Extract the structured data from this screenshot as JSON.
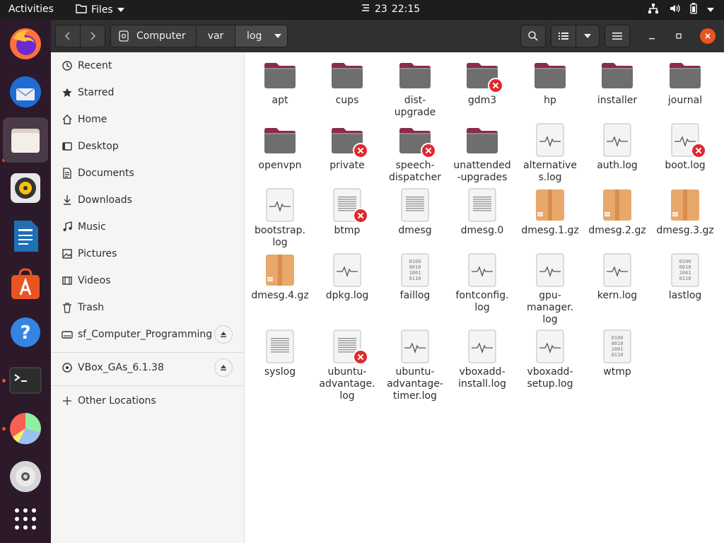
{
  "topbar": {
    "activities": "Activities",
    "app_name": "Files",
    "clock_date": "23",
    "clock_time": "22:15"
  },
  "dock": {
    "items": [
      "firefox",
      "thunderbird",
      "files",
      "rhythmbox",
      "libreoffice-writer",
      "ubuntu-software",
      "help",
      "terminal",
      "disk-usage",
      "dvd",
      "show-applications"
    ]
  },
  "breadcrumb": {
    "items": [
      "Computer",
      "var",
      "log"
    ]
  },
  "sidebar": {
    "items": [
      {
        "label": "Recent",
        "icon": "clock-icon"
      },
      {
        "label": "Starred",
        "icon": "star-icon"
      },
      {
        "label": "Home",
        "icon": "home-icon"
      },
      {
        "label": "Desktop",
        "icon": "desktop-icon"
      },
      {
        "label": "Documents",
        "icon": "document-icon"
      },
      {
        "label": "Downloads",
        "icon": "download-icon"
      },
      {
        "label": "Music",
        "icon": "music-icon"
      },
      {
        "label": "Pictures",
        "icon": "picture-icon"
      },
      {
        "label": "Videos",
        "icon": "video-icon"
      },
      {
        "label": "Trash",
        "icon": "trash-icon"
      },
      {
        "label": "sf_Computer_Programming",
        "icon": "drive-icon"
      },
      {
        "label": "VBox_GAs_6.1.38",
        "icon": "disc-icon"
      },
      {
        "label": "Other Locations",
        "icon": "plus-icon"
      }
    ]
  },
  "files": [
    {
      "name": "apt",
      "type": "folder",
      "locked": false
    },
    {
      "name": "cups",
      "type": "folder",
      "locked": false
    },
    {
      "name": "dist-\nupgrade",
      "type": "folder",
      "locked": false
    },
    {
      "name": "gdm3",
      "type": "folder",
      "locked": true
    },
    {
      "name": "hp",
      "type": "folder",
      "locked": false
    },
    {
      "name": "installer",
      "type": "folder",
      "locked": false
    },
    {
      "name": "journal",
      "type": "folder",
      "locked": false
    },
    {
      "name": "openvpn",
      "type": "folder",
      "locked": false
    },
    {
      "name": "private",
      "type": "folder",
      "locked": true
    },
    {
      "name": "speech-\ndispatcher",
      "type": "folder",
      "locked": true
    },
    {
      "name": "unattended\n-upgrades",
      "type": "folder",
      "locked": false
    },
    {
      "name": "alternative\ns.log",
      "type": "log",
      "locked": false
    },
    {
      "name": "auth.log",
      "type": "log",
      "locked": false
    },
    {
      "name": "boot.log",
      "type": "log",
      "locked": true
    },
    {
      "name": "bootstrap.\nlog",
      "type": "log",
      "locked": false
    },
    {
      "name": "btmp",
      "type": "text",
      "locked": true
    },
    {
      "name": "dmesg",
      "type": "text",
      "locked": false
    },
    {
      "name": "dmesg.0",
      "type": "text",
      "locked": false
    },
    {
      "name": "dmesg.1.gz",
      "type": "archive",
      "locked": false
    },
    {
      "name": "dmesg.2.gz",
      "type": "archive",
      "locked": false
    },
    {
      "name": "dmesg.3.gz",
      "type": "archive",
      "locked": false
    },
    {
      "name": "dmesg.4.gz",
      "type": "archive",
      "locked": false
    },
    {
      "name": "dpkg.log",
      "type": "log",
      "locked": false
    },
    {
      "name": "faillog",
      "type": "binary",
      "locked": false
    },
    {
      "name": "fontconfig.\nlog",
      "type": "log",
      "locked": false
    },
    {
      "name": "gpu-\nmanager.\nlog",
      "type": "log",
      "locked": false
    },
    {
      "name": "kern.log",
      "type": "log",
      "locked": false
    },
    {
      "name": "lastlog",
      "type": "binary",
      "locked": false
    },
    {
      "name": "syslog",
      "type": "text",
      "locked": false
    },
    {
      "name": "ubuntu-\nadvantage.\nlog",
      "type": "text",
      "locked": true
    },
    {
      "name": "ubuntu-\nadvantage-\ntimer.log",
      "type": "log",
      "locked": false
    },
    {
      "name": "vboxadd-\ninstall.log",
      "type": "log",
      "locked": false
    },
    {
      "name": "vboxadd-\nsetup.log",
      "type": "log",
      "locked": false
    },
    {
      "name": "wtmp",
      "type": "binary",
      "locked": false
    }
  ],
  "binary_text": [
    "0100",
    "0010",
    "1001",
    "0110"
  ],
  "colors": {
    "folder_top": "#8c2a4f",
    "folder_body": "#6e6e6e",
    "archive": "#e8a86a",
    "lock_badge": "#e0292f",
    "accent": "#e95420"
  }
}
